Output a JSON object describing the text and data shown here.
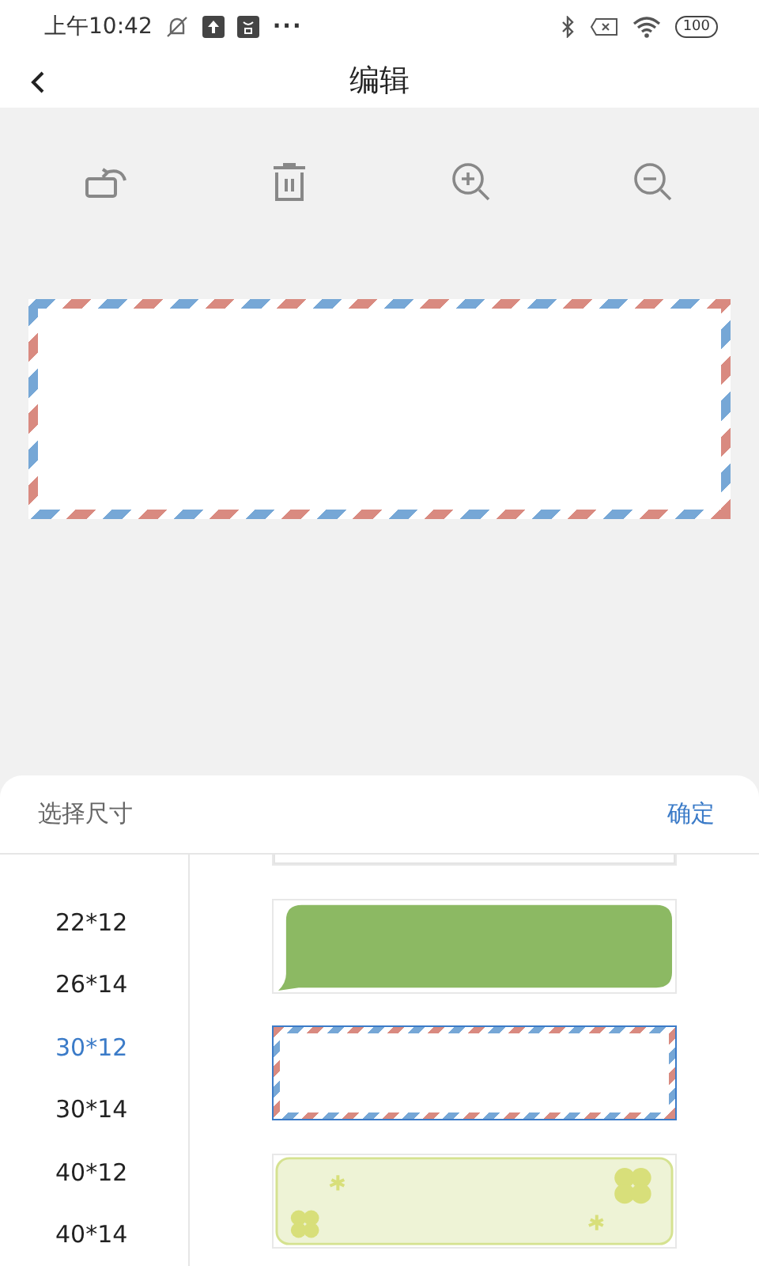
{
  "status_bar": {
    "time": "上午10:42",
    "more": "···",
    "battery": "100"
  },
  "header": {
    "title": "编辑"
  },
  "toolbar": {
    "buttons": [
      {
        "kind": "rotate"
      },
      {
        "kind": "delete"
      },
      {
        "kind": "zoom_in"
      },
      {
        "kind": "zoom_out"
      }
    ]
  },
  "canvas": {
    "label": {
      "kind": "airmail"
    }
  },
  "sheet": {
    "title": "选择尺寸",
    "confirm": "确定",
    "sizes": [
      {
        "label": "22*12",
        "selected": false
      },
      {
        "label": "26*14",
        "selected": false
      },
      {
        "label": "30*12",
        "selected": true
      },
      {
        "label": "30*14",
        "selected": false
      },
      {
        "label": "40*12",
        "selected": false
      },
      {
        "label": "40*14",
        "selected": false
      }
    ],
    "templates": [
      {
        "kind": "plain",
        "selected": false
      },
      {
        "kind": "bubble",
        "selected": false
      },
      {
        "kind": "airmail",
        "selected": true
      },
      {
        "kind": "clover",
        "selected": false
      }
    ]
  }
}
